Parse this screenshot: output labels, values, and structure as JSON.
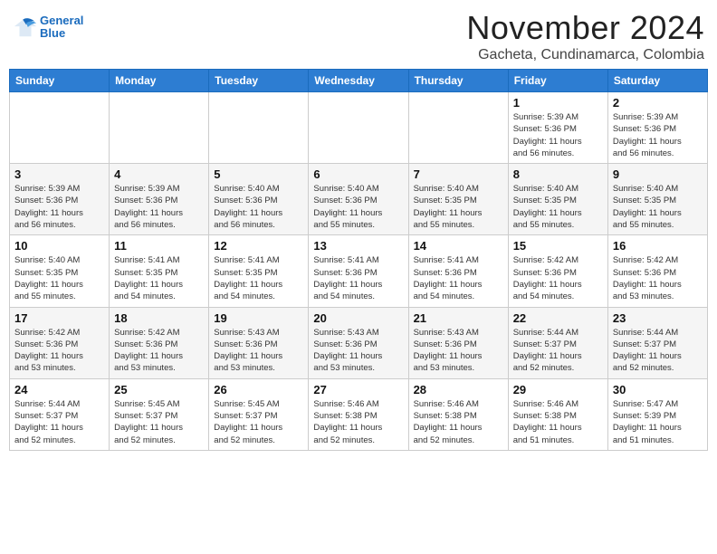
{
  "header": {
    "logo_line1": "General",
    "logo_line2": "Blue",
    "month": "November 2024",
    "location": "Gacheta, Cundinamarca, Colombia"
  },
  "days_of_week": [
    "Sunday",
    "Monday",
    "Tuesday",
    "Wednesday",
    "Thursday",
    "Friday",
    "Saturday"
  ],
  "weeks": [
    [
      {
        "day": "",
        "info": ""
      },
      {
        "day": "",
        "info": ""
      },
      {
        "day": "",
        "info": ""
      },
      {
        "day": "",
        "info": ""
      },
      {
        "day": "",
        "info": ""
      },
      {
        "day": "1",
        "info": "Sunrise: 5:39 AM\nSunset: 5:36 PM\nDaylight: 11 hours\nand 56 minutes."
      },
      {
        "day": "2",
        "info": "Sunrise: 5:39 AM\nSunset: 5:36 PM\nDaylight: 11 hours\nand 56 minutes."
      }
    ],
    [
      {
        "day": "3",
        "info": "Sunrise: 5:39 AM\nSunset: 5:36 PM\nDaylight: 11 hours\nand 56 minutes."
      },
      {
        "day": "4",
        "info": "Sunrise: 5:39 AM\nSunset: 5:36 PM\nDaylight: 11 hours\nand 56 minutes."
      },
      {
        "day": "5",
        "info": "Sunrise: 5:40 AM\nSunset: 5:36 PM\nDaylight: 11 hours\nand 56 minutes."
      },
      {
        "day": "6",
        "info": "Sunrise: 5:40 AM\nSunset: 5:36 PM\nDaylight: 11 hours\nand 55 minutes."
      },
      {
        "day": "7",
        "info": "Sunrise: 5:40 AM\nSunset: 5:35 PM\nDaylight: 11 hours\nand 55 minutes."
      },
      {
        "day": "8",
        "info": "Sunrise: 5:40 AM\nSunset: 5:35 PM\nDaylight: 11 hours\nand 55 minutes."
      },
      {
        "day": "9",
        "info": "Sunrise: 5:40 AM\nSunset: 5:35 PM\nDaylight: 11 hours\nand 55 minutes."
      }
    ],
    [
      {
        "day": "10",
        "info": "Sunrise: 5:40 AM\nSunset: 5:35 PM\nDaylight: 11 hours\nand 55 minutes."
      },
      {
        "day": "11",
        "info": "Sunrise: 5:41 AM\nSunset: 5:35 PM\nDaylight: 11 hours\nand 54 minutes."
      },
      {
        "day": "12",
        "info": "Sunrise: 5:41 AM\nSunset: 5:35 PM\nDaylight: 11 hours\nand 54 minutes."
      },
      {
        "day": "13",
        "info": "Sunrise: 5:41 AM\nSunset: 5:36 PM\nDaylight: 11 hours\nand 54 minutes."
      },
      {
        "day": "14",
        "info": "Sunrise: 5:41 AM\nSunset: 5:36 PM\nDaylight: 11 hours\nand 54 minutes."
      },
      {
        "day": "15",
        "info": "Sunrise: 5:42 AM\nSunset: 5:36 PM\nDaylight: 11 hours\nand 54 minutes."
      },
      {
        "day": "16",
        "info": "Sunrise: 5:42 AM\nSunset: 5:36 PM\nDaylight: 11 hours\nand 53 minutes."
      }
    ],
    [
      {
        "day": "17",
        "info": "Sunrise: 5:42 AM\nSunset: 5:36 PM\nDaylight: 11 hours\nand 53 minutes."
      },
      {
        "day": "18",
        "info": "Sunrise: 5:42 AM\nSunset: 5:36 PM\nDaylight: 11 hours\nand 53 minutes."
      },
      {
        "day": "19",
        "info": "Sunrise: 5:43 AM\nSunset: 5:36 PM\nDaylight: 11 hours\nand 53 minutes."
      },
      {
        "day": "20",
        "info": "Sunrise: 5:43 AM\nSunset: 5:36 PM\nDaylight: 11 hours\nand 53 minutes."
      },
      {
        "day": "21",
        "info": "Sunrise: 5:43 AM\nSunset: 5:36 PM\nDaylight: 11 hours\nand 53 minutes."
      },
      {
        "day": "22",
        "info": "Sunrise: 5:44 AM\nSunset: 5:37 PM\nDaylight: 11 hours\nand 52 minutes."
      },
      {
        "day": "23",
        "info": "Sunrise: 5:44 AM\nSunset: 5:37 PM\nDaylight: 11 hours\nand 52 minutes."
      }
    ],
    [
      {
        "day": "24",
        "info": "Sunrise: 5:44 AM\nSunset: 5:37 PM\nDaylight: 11 hours\nand 52 minutes."
      },
      {
        "day": "25",
        "info": "Sunrise: 5:45 AM\nSunset: 5:37 PM\nDaylight: 11 hours\nand 52 minutes."
      },
      {
        "day": "26",
        "info": "Sunrise: 5:45 AM\nSunset: 5:37 PM\nDaylight: 11 hours\nand 52 minutes."
      },
      {
        "day": "27",
        "info": "Sunrise: 5:46 AM\nSunset: 5:38 PM\nDaylight: 11 hours\nand 52 minutes."
      },
      {
        "day": "28",
        "info": "Sunrise: 5:46 AM\nSunset: 5:38 PM\nDaylight: 11 hours\nand 52 minutes."
      },
      {
        "day": "29",
        "info": "Sunrise: 5:46 AM\nSunset: 5:38 PM\nDaylight: 11 hours\nand 51 minutes."
      },
      {
        "day": "30",
        "info": "Sunrise: 5:47 AM\nSunset: 5:39 PM\nDaylight: 11 hours\nand 51 minutes."
      }
    ]
  ]
}
